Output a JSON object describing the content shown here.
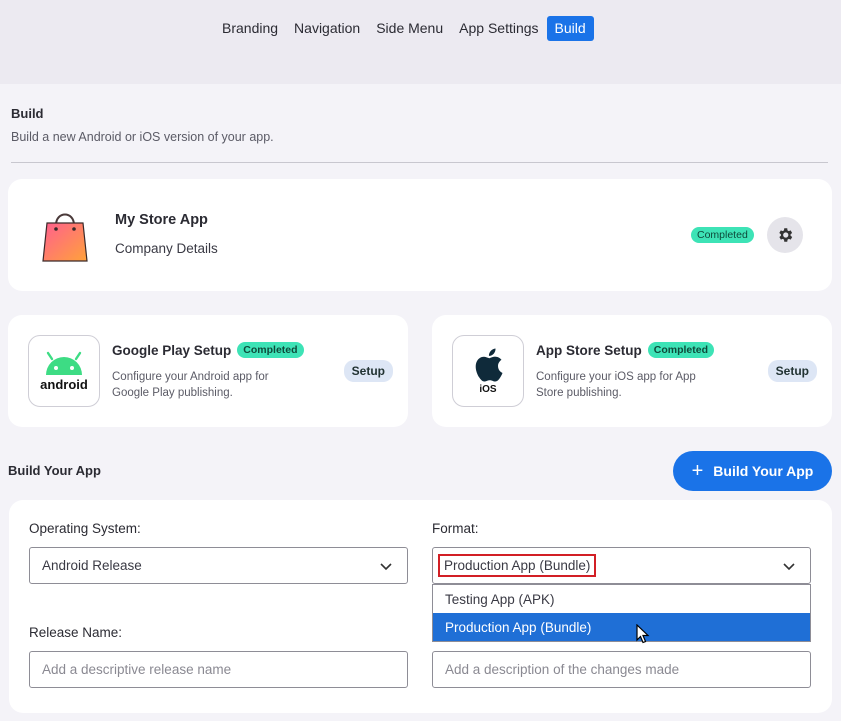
{
  "tabs": [
    {
      "label": "Branding"
    },
    {
      "label": "Navigation"
    },
    {
      "label": "Side Menu"
    },
    {
      "label": "App Settings"
    },
    {
      "label": "Build",
      "active": true
    }
  ],
  "section": {
    "title": "Build",
    "subtitle": "Build a new Android or iOS version of your app."
  },
  "app": {
    "name": "My Store App",
    "company": "Company Details",
    "status": "Completed"
  },
  "google_play": {
    "logo_text": "android",
    "title": "Google Play Setup",
    "status": "Completed",
    "description": "Configure your Android app for Google Play publishing.",
    "button": "Setup"
  },
  "app_store": {
    "logo_text": "iOS",
    "title": "App Store Setup",
    "status": "Completed",
    "description": "Configure your iOS app for App Store publishing.",
    "button": "Setup"
  },
  "build": {
    "title": "Build Your App",
    "button": "Build Your App"
  },
  "form": {
    "os_label": "Operating System:",
    "os_value": "Android Release",
    "format_label": "Format:",
    "format_value": "Production App (Bundle)",
    "format_options": [
      "Testing App (APK)",
      "Production App (Bundle)"
    ],
    "release_label": "Release Name:",
    "release_placeholder": "Add a descriptive release name",
    "changes_placeholder": "Add a description of the changes made"
  },
  "colors": {
    "accent": "#1a73e8",
    "badge": "#3de3b6",
    "highlight_border": "#d21f25"
  }
}
